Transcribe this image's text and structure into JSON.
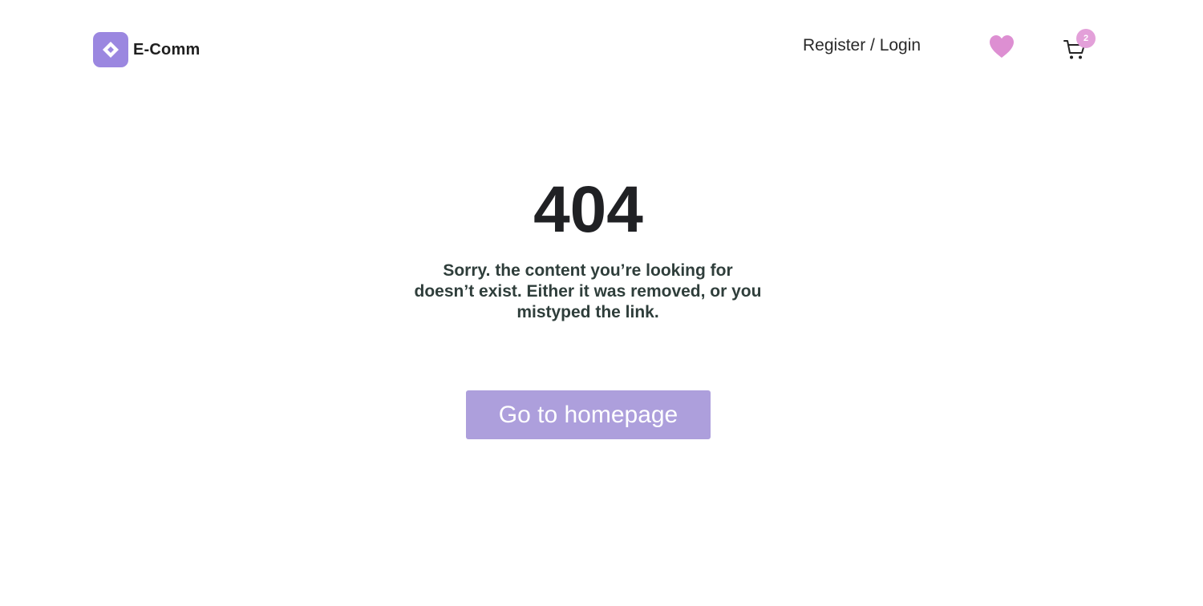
{
  "header": {
    "brand": "E-Comm",
    "auth_link": "Register / Login",
    "wishlist_icon": "heart-icon",
    "cart_icon": "cart-icon",
    "cart_count": "2"
  },
  "main": {
    "error_code": "404",
    "message": "Sorry. the content you’re looking for doesn’t exist. Either it was removed, or you mistyped the link.",
    "button_label": "Go to homepage"
  },
  "colors": {
    "brand": "#9b87e0",
    "heart": "#dd8fd2",
    "badge": "#e3a0d9",
    "button": "#ad9fdc"
  }
}
